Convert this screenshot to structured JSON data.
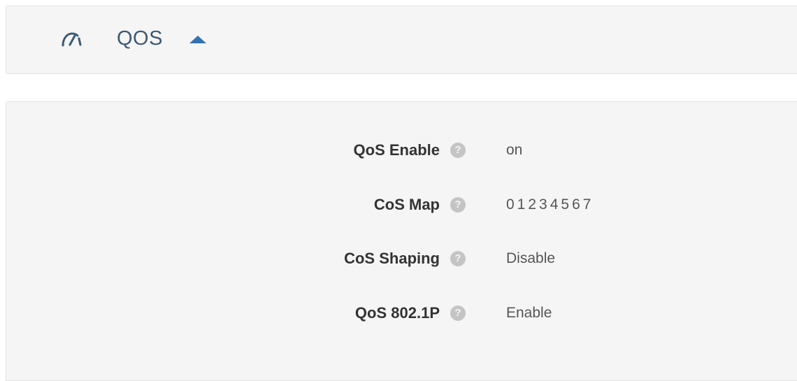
{
  "section": {
    "icon": "speedometer-icon",
    "title": "QOS",
    "collapse_icon": "caret-up-icon",
    "accent_color": "#2f74b5",
    "title_color": "#3e5a73"
  },
  "settings": {
    "rows": [
      {
        "label": "QoS Enable",
        "help_icon": "help-icon",
        "help_glyph": "?",
        "value": "on"
      },
      {
        "label": "CoS Map",
        "help_icon": "help-icon",
        "help_glyph": "?",
        "value": "01234567"
      },
      {
        "label": "CoS Shaping",
        "help_icon": "help-icon",
        "help_glyph": "?",
        "value": "Disable"
      },
      {
        "label": "QoS 802.1P",
        "help_icon": "help-icon",
        "help_glyph": "?",
        "value": "Enable"
      }
    ]
  }
}
